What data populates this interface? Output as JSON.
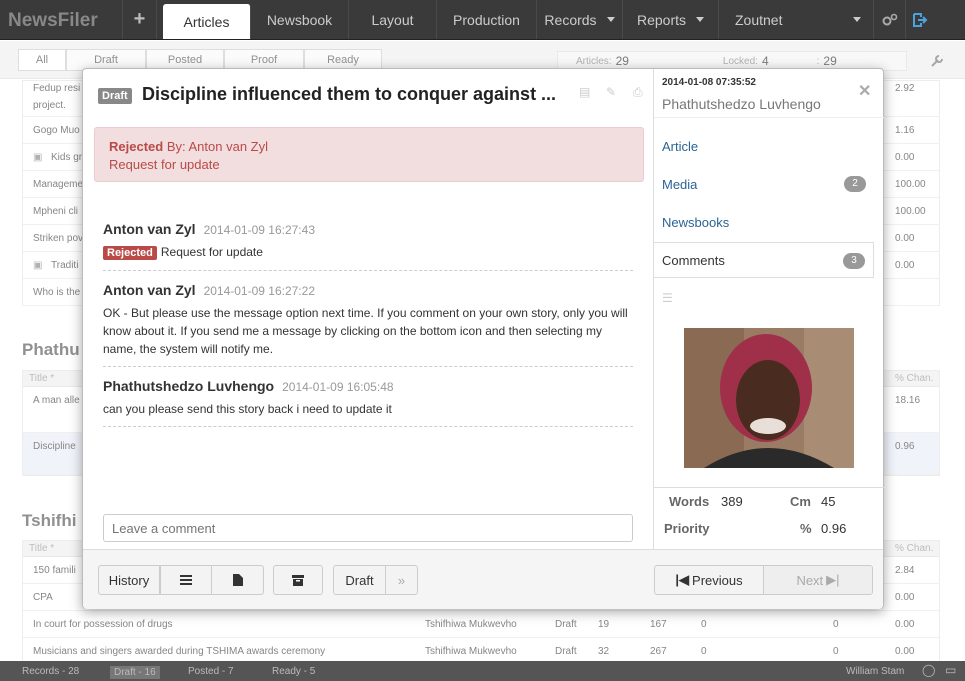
{
  "app": {
    "brand": "NewsFiler",
    "plus": "+"
  },
  "nav": {
    "articles": "Articles",
    "newsbook": "Newsbook",
    "layout": "Layout",
    "production": "Production",
    "records": "Records",
    "reports": "Reports",
    "zoutnet": "Zoutnet"
  },
  "filters": {
    "all": "All",
    "draft": "Draft",
    "posted": "Posted",
    "proof": "Proof",
    "ready": "Ready"
  },
  "counts": {
    "articles_label": "Articles:",
    "articles": "29",
    "locked_label": "Locked:",
    "locked": "4",
    "other": "29"
  },
  "bg": {
    "rows1": [
      {
        "title": "Fedup resi",
        "title2": "project.",
        "pct": "2.92"
      },
      {
        "title": "Gogo Muo",
        "pct": "1.16"
      },
      {
        "title": "Kids gr",
        "pct": "0.00",
        "img": true
      },
      {
        "title": "Manageme",
        "pct": "100.00"
      },
      {
        "title": "Mpheni cli",
        "pct": "100.00"
      },
      {
        "title": "Striken pov",
        "pct": "0.00"
      },
      {
        "title": "Traditi",
        "pct": "0.00",
        "img": true
      },
      {
        "title": "Who is the",
        "pct": ""
      }
    ],
    "section2": "Phathu",
    "col_title": "Title *",
    "col_pct": "% Chan.",
    "rows2": [
      {
        "title": "A man alle",
        "pct": "18.16"
      },
      {
        "title": "Discipline",
        "pct": "0.96"
      }
    ],
    "section3": "Tshifhi",
    "rows3": [
      {
        "title": "150 famili",
        "pct": "2.84"
      },
      {
        "title": "CPA",
        "pct": "0.00"
      },
      {
        "title": "In court for possession of drugs",
        "author": "Tshifhiwa Mukwevho",
        "status": "Draft",
        "a": "19",
        "b": "167",
        "c": "0",
        "d": "0",
        "pct": "0.00"
      },
      {
        "title": "Musicians and singers awarded during TSHIMA awards ceremony",
        "author": "Tshifhiwa Mukwevho",
        "status": "Draft",
        "a": "32",
        "b": "267",
        "c": "0",
        "d": "0",
        "pct": "0.00"
      }
    ]
  },
  "status": {
    "records": "Records - 28",
    "draft": "Draft - 16",
    "posted": "Posted - 7",
    "ready": "Ready - 5",
    "user": "William Stam"
  },
  "modal": {
    "badge": "Draft",
    "title": "Discipline influenced them to conquer against ...",
    "alert": {
      "status": "Rejected",
      "by": "By: Anton van Zyl",
      "message": "Request for update"
    },
    "comments": [
      {
        "author": "Anton van Zyl",
        "time": "2014-01-09 16:27:43",
        "label": "Rejected",
        "body": "Request for update"
      },
      {
        "author": "Anton van Zyl",
        "time": "2014-01-09 16:27:22",
        "body": "OK - But please use the message option next time. If you comment on your own story, only you will know about it. If you send me a message by clicking on the bottom icon and then selecting my name, the system will notify me."
      },
      {
        "author": "Phathutshedzo Luvhengo",
        "time": "2014-01-09 16:05:48",
        "body": "can you please send this story back i need to update it"
      }
    ],
    "comment_placeholder": "Leave a comment",
    "footer": {
      "history": "History",
      "draft": "Draft",
      "previous": "Previous",
      "next": "Next"
    },
    "sidebar": {
      "date": "2014-01-08 07:35:52",
      "author": "Phathutshedzo Luvhengo",
      "tabs": {
        "article": "Article",
        "media": "Media",
        "media_count": "2",
        "newsbooks": "Newsbooks",
        "comments": "Comments",
        "comments_count": "3"
      },
      "stats": {
        "words_label": "Words",
        "words": "389",
        "cm_label": "Cm",
        "cm": "45",
        "priority_label": "Priority",
        "pct_label": "%",
        "pct": "0.96"
      }
    }
  }
}
